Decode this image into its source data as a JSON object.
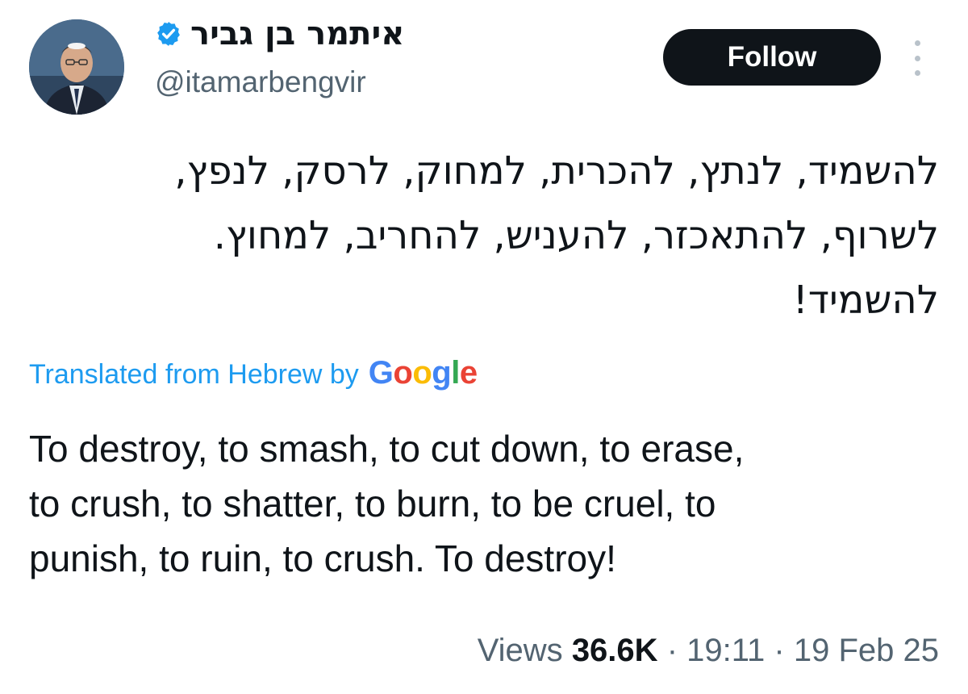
{
  "author": {
    "display_name": "איתמר בן גביר",
    "handle": "@itamarbengvir",
    "verified": true
  },
  "follow_label": "Follow",
  "tweet": {
    "hebrew_lines": [
      "להשמיד, לנתץ, להכרית, למחוק, לרסק, לנפץ,",
      "לשרוף, להתאכזר, להעניש, להחריב, למחוץ.",
      "להשמיד!"
    ],
    "translation_prefix": "Translated from Hebrew by",
    "translation_provider": "Google",
    "english_lines": [
      "To destroy, to smash, to cut down, to erase,",
      "to crush, to shatter, to burn, to be cruel, to",
      "punish, to ruin, to crush. To destroy!"
    ]
  },
  "meta": {
    "views_label": "Views",
    "views_count": "36.6K",
    "separator": "·",
    "time": "19:11",
    "date": "19 Feb 25"
  },
  "colors": {
    "text": "#0f1419",
    "secondary": "#536471",
    "link": "#1d9bf0",
    "button_bg": "#0f1419",
    "verified": "#1d9bf0",
    "google_blue": "#4285F4",
    "google_red": "#EA4335",
    "google_yellow": "#FBBC05",
    "google_green": "#34A853"
  },
  "icons": [
    "avatar",
    "verified-badge-icon",
    "more-options-icon",
    "google-logo"
  ]
}
